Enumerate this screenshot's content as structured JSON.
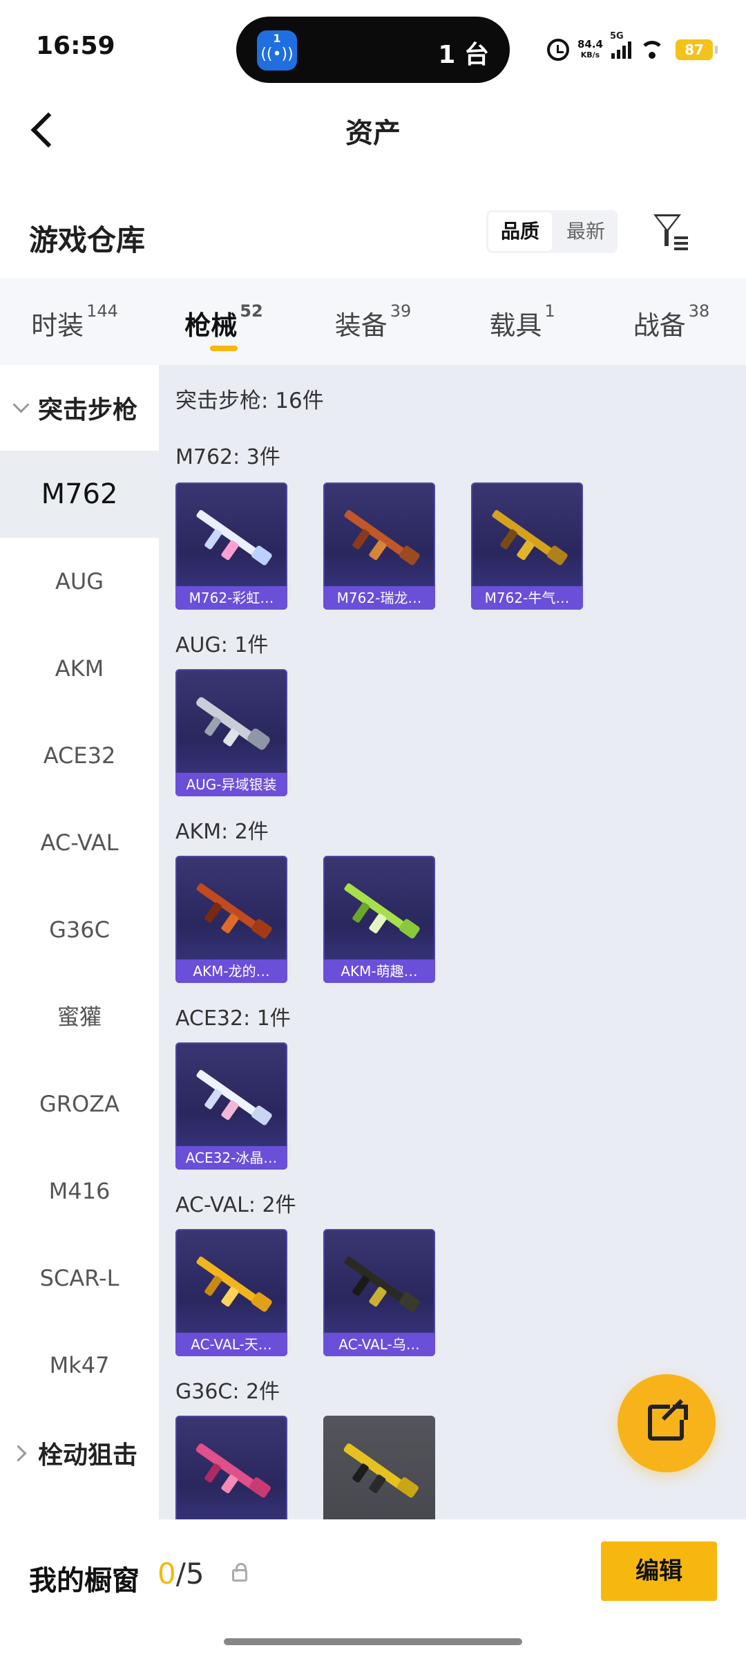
{
  "status": {
    "time": "16:59",
    "island_badge": "1",
    "island_count": "1 台",
    "net_speed": "84.4",
    "net_unit": "KB/s",
    "network": "5G",
    "battery": "87"
  },
  "nav": {
    "title": "资产"
  },
  "header": {
    "title": "游戏仓库",
    "sort_quality": "品质",
    "sort_newest": "最新"
  },
  "tabs": [
    {
      "label": "时装",
      "count": "144"
    },
    {
      "label": "枪械",
      "count": "52"
    },
    {
      "label": "装备",
      "count": "39"
    },
    {
      "label": "载具",
      "count": "1"
    },
    {
      "label": "战备",
      "count": "38"
    }
  ],
  "sidebar": {
    "category": "突击步枪",
    "next_category": "栓动狙击",
    "items": [
      "M762",
      "AUG",
      "AKM",
      "ACE32",
      "AC-VAL",
      "G36C",
      "蜜獾",
      "GROZA",
      "M416",
      "SCAR-L",
      "Mk47"
    ]
  },
  "main": {
    "summary": "突击步枪: 16件",
    "groups": [
      {
        "title": "M762: 3件",
        "items": [
          "M762-彩虹…",
          "M762-瑞龙…",
          "M762-牛气…"
        ]
      },
      {
        "title": "AUG: 1件",
        "items": [
          "AUG-异域银装"
        ]
      },
      {
        "title": "AKM: 2件",
        "items": [
          "AKM-龙的…",
          "AKM-萌趣…"
        ]
      },
      {
        "title": "ACE32: 1件",
        "items": [
          "ACE32-冰晶…"
        ]
      },
      {
        "title": "AC-VAL: 2件",
        "items": [
          "AC-VAL-天…",
          "AC-VAL-乌…"
        ]
      },
      {
        "title": "G36C: 2件",
        "items": []
      }
    ]
  },
  "bottom": {
    "shelf_label": "我的橱窗",
    "used": "0",
    "total": "/5",
    "edit": "编辑"
  },
  "colors": {
    "accent": "#f6b70f",
    "card_label": "#6a4fd9",
    "card_bg": "#2a275e"
  },
  "icons": [
    "back-arrow-icon",
    "filter-icon",
    "lock-icon",
    "share-icon"
  ]
}
